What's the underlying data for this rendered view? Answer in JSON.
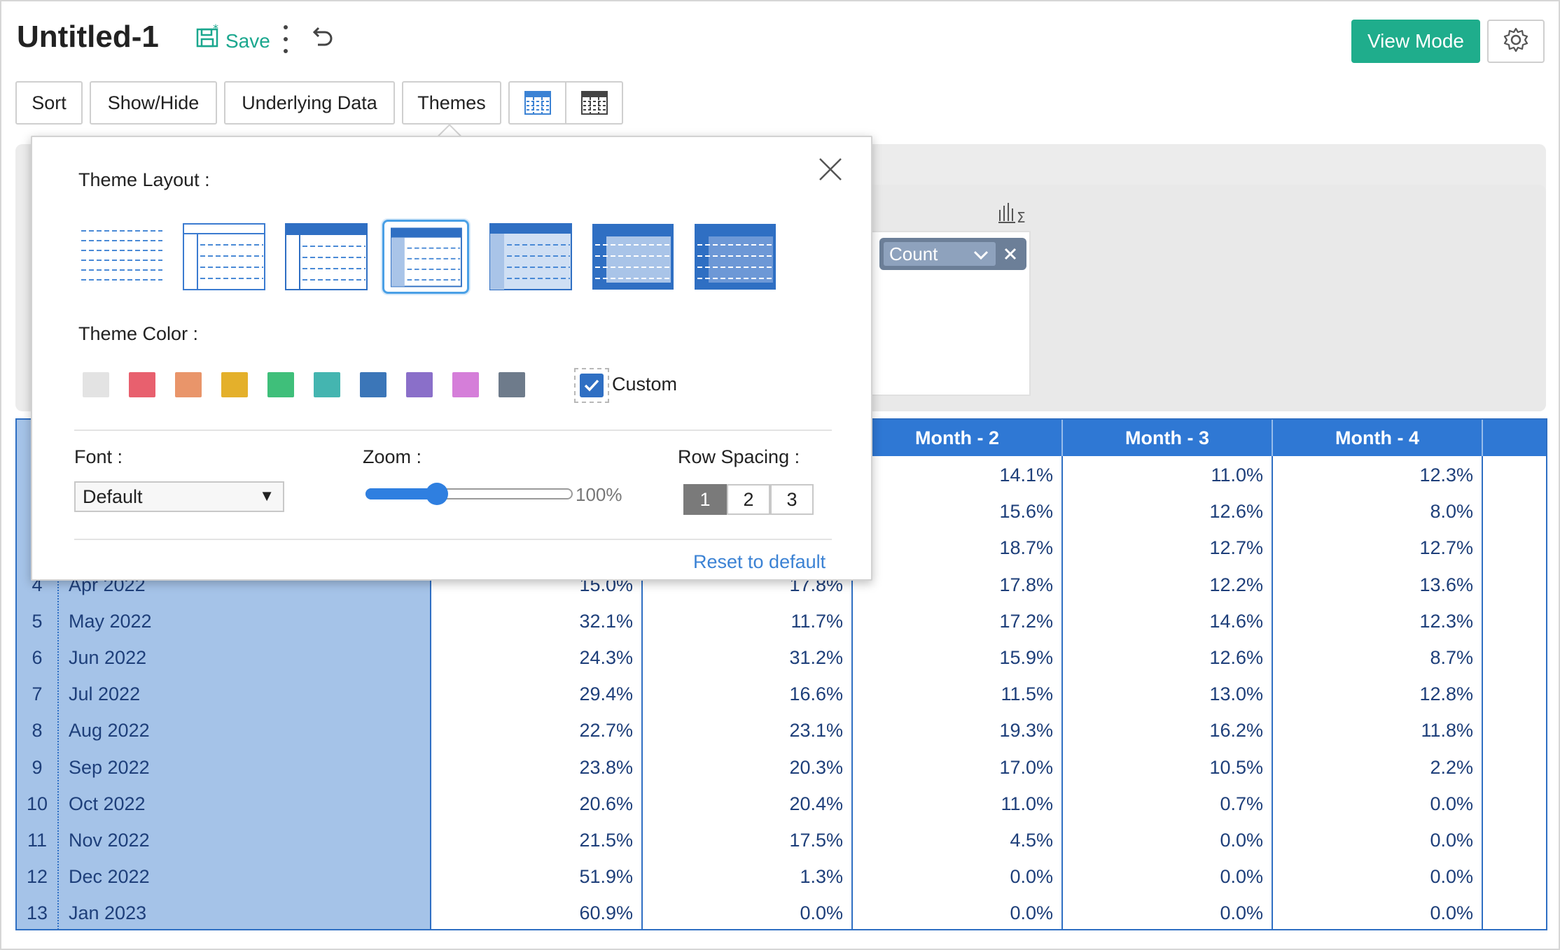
{
  "header": {
    "title": "Untitled-1",
    "save_label": "Save",
    "view_mode_label": "View Mode"
  },
  "toolbar": {
    "sort": "Sort",
    "show_hide": "Show/Hide",
    "underlying_data": "Underlying Data",
    "themes": "Themes"
  },
  "drop_zone": {
    "measure_label": "Count"
  },
  "theme_popover": {
    "layout_label": "Theme Layout :",
    "color_label": "Theme Color :",
    "custom_label": "Custom",
    "custom_checked": true,
    "font_label": "Font :",
    "font_value": "Default",
    "zoom_label": "Zoom :",
    "zoom_value": "100%",
    "zoom_fraction": 0.28,
    "row_spacing_label": "Row Spacing :",
    "row_spacing_options": [
      "1",
      "2",
      "3"
    ],
    "row_spacing_selected": "1",
    "reset_label": "Reset to default",
    "selected_layout": 4,
    "colors": [
      "#e3e3e3",
      "#e8606e",
      "#e9956a",
      "#e4b02b",
      "#3fbf7a",
      "#44b5b0",
      "#3b76b8",
      "#8a6fc9",
      "#d57ed9",
      "#6e7b8b"
    ]
  },
  "table": {
    "headers": [
      "Month - 2",
      "Month - 3",
      "Month - 4"
    ],
    "rows": [
      {
        "idx": "",
        "month": "",
        "cols": [
          "",
          "",
          "14.1%",
          "11.0%",
          "12.3%"
        ]
      },
      {
        "idx": "",
        "month": "",
        "cols": [
          "",
          "",
          "15.6%",
          "12.6%",
          "8.0%"
        ]
      },
      {
        "idx": "",
        "month": "",
        "cols": [
          "",
          "",
          "18.7%",
          "12.7%",
          "12.7%"
        ]
      },
      {
        "idx": "4",
        "month": "Apr 2022",
        "cols": [
          "15.0%",
          "17.8%",
          "17.8%",
          "12.2%",
          "13.6%"
        ]
      },
      {
        "idx": "5",
        "month": "May 2022",
        "cols": [
          "32.1%",
          "11.7%",
          "17.2%",
          "14.6%",
          "12.3%"
        ]
      },
      {
        "idx": "6",
        "month": "Jun 2022",
        "cols": [
          "24.3%",
          "31.2%",
          "15.9%",
          "12.6%",
          "8.7%"
        ]
      },
      {
        "idx": "7",
        "month": "Jul 2022",
        "cols": [
          "29.4%",
          "16.6%",
          "11.5%",
          "13.0%",
          "12.8%"
        ]
      },
      {
        "idx": "8",
        "month": "Aug 2022",
        "cols": [
          "22.7%",
          "23.1%",
          "19.3%",
          "16.2%",
          "11.8%"
        ]
      },
      {
        "idx": "9",
        "month": "Sep 2022",
        "cols": [
          "23.8%",
          "20.3%",
          "17.0%",
          "10.5%",
          "2.2%"
        ]
      },
      {
        "idx": "10",
        "month": "Oct 2022",
        "cols": [
          "20.6%",
          "20.4%",
          "11.0%",
          "0.7%",
          "0.0%"
        ]
      },
      {
        "idx": "11",
        "month": "Nov 2022",
        "cols": [
          "21.5%",
          "17.5%",
          "4.5%",
          "0.0%",
          "0.0%"
        ]
      },
      {
        "idx": "12",
        "month": "Dec 2022",
        "cols": [
          "51.9%",
          "1.3%",
          "0.0%",
          "0.0%",
          "0.0%"
        ]
      },
      {
        "idx": "13",
        "month": "Jan 2023",
        "cols": [
          "60.9%",
          "0.0%",
          "0.0%",
          "0.0%",
          "0.0%"
        ]
      }
    ]
  }
}
